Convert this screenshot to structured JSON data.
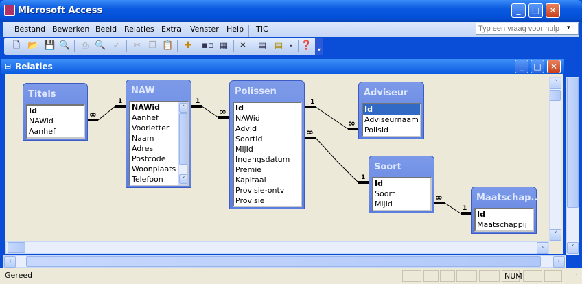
{
  "app": {
    "title": "Microsoft Access"
  },
  "menu": [
    "Bestand",
    "Bewerken",
    "Beeld",
    "Relaties",
    "Extra",
    "Venster",
    "Help",
    "TIC"
  ],
  "help": {
    "placeholder": "Typ een vraag voor hulp"
  },
  "window": {
    "title": "Relaties"
  },
  "tables": [
    {
      "name": "Titels",
      "fields": [
        "Id",
        "NAWid",
        "Aanhef"
      ]
    },
    {
      "name": "NAW",
      "fields": [
        "NAWid",
        "Aanhef",
        "Voorletter",
        "Naam",
        "Adres",
        "Postcode",
        "Woonplaats",
        "Telefoon"
      ]
    },
    {
      "name": "Polissen",
      "fields": [
        "Id",
        "NAWid",
        "AdvId",
        "SoortId",
        "MijId",
        "Ingangsdatum",
        "Premie",
        "Kapitaal",
        "Provisie-ontv",
        "Provisie"
      ]
    },
    {
      "name": "Adviseur",
      "fields": [
        "Id",
        "Adviseurnaam",
        "PolisId"
      ]
    },
    {
      "name": "Soort",
      "fields": [
        "Id",
        "Soort",
        "MijId"
      ]
    },
    {
      "name": "Maatschap...",
      "fields": [
        "Id",
        "Maatschappij"
      ]
    }
  ],
  "cardinality": {
    "one": "1",
    "many": "∞"
  },
  "status": {
    "text": "Gereed",
    "num": "NUM"
  }
}
